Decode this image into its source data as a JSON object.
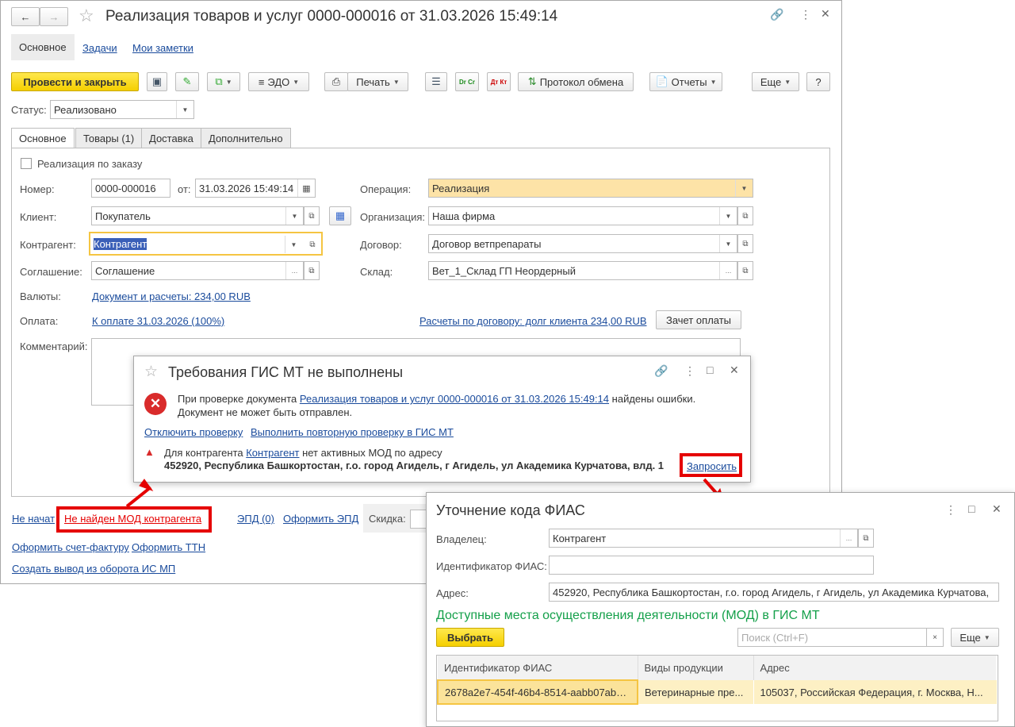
{
  "main": {
    "title": "Реализация товаров и услуг 0000-000016 от 31.03.2026 15:49:14",
    "nav_tabs": [
      "Основное",
      "Задачи",
      "Мои заметки"
    ],
    "toolbar": {
      "post_close": "Провести и закрыть",
      "edo": "ЭДО",
      "print": "Печать",
      "exchange_log": "Протокол обмена",
      "reports": "Отчеты",
      "more": "Еще",
      "help": "?",
      "dr_cr": "Dr Cr",
      "dt_kt": "Дт Кт"
    },
    "status_label": "Статус:",
    "status_value": "Реализовано",
    "tabs": [
      "Основное",
      "Товары (1)",
      "Доставка",
      "Дополнительно"
    ],
    "by_order": "Реализация по заказу",
    "fields": {
      "number_label": "Номер:",
      "number": "0000-000016",
      "from_label": "от:",
      "date": "31.03.2026 15:49:14",
      "client_label": "Клиент:",
      "client": "Покупатель",
      "counterparty_label": "Контрагент:",
      "counterparty": "Контрагент",
      "agreement_label": "Соглашение:",
      "agreement": "Соглашение",
      "currency_label": "Валюты:",
      "currency_link": "Документ и расчеты: 234,00 RUB",
      "payment_label": "Оплата:",
      "payment_link": "К оплате 31.03.2026 (100%)",
      "settlements_link": "Расчеты по договору: долг клиента 234,00 RUB",
      "offset_button": "Зачет оплаты",
      "comment_label": "Комментарий:",
      "operation_label": "Операция:",
      "operation": "Реализация",
      "org_label": "Организация:",
      "org": "Наша фирма",
      "contract_label": "Договор:",
      "contract": "Договор ветпрепараты",
      "warehouse_label": "Склад:",
      "warehouse": "Вет_1_Склад ГП Неордерный"
    },
    "footer": {
      "not_started": "Не начат",
      "mod_not_found": "Не найден МОД контрагента",
      "epd": "ЭПД (0)",
      "make_epd": "Оформить ЭПД",
      "discount_label": "Скидка:",
      "make_invoice": "Оформить счет-фактуру",
      "make_ttn": "Оформить ТТН",
      "create_withdrawal": "Создать вывод из оборота ИС МП"
    }
  },
  "gis_dialog": {
    "title": "Требования ГИС МТ не выполнены",
    "msg_prefix": "При проверке документа",
    "msg_link": "Реализация товаров и услуг 0000-000016 от 31.03.2026 15:49:14",
    "msg_suffix": "найдены ошибки.",
    "msg_line2": "Документ не может быть отправлен.",
    "disable_check": "Отключить проверку",
    "recheck": "Выполнить повторную проверку в ГИС МТ",
    "warn_prefix": "Для контрагента",
    "warn_link": "Контрагент",
    "warn_suffix": "нет активных МОД по адресу",
    "address": "452920, Республика Башкортостан, г.о. город Агидель, г Агидель, ул Академика Курчатова, влд. 1",
    "request": "Запросить"
  },
  "fias_dialog": {
    "title": "Уточнение кода ФИАС",
    "owner_label": "Владелец:",
    "owner": "Контрагент",
    "fias_id_label": "Идентификатор ФИАС:",
    "fias_id": "",
    "address_label": "Адрес:",
    "address": "452920, Республика Башкортостан, г.о. город Агидель, г Агидель, ул Академика Курчатова,",
    "section_title": "Доступные места осуществления деятельности (МОД) в ГИС МТ",
    "select": "Выбрать",
    "search_placeholder": "Поиск (Ctrl+F)",
    "more": "Еще",
    "columns": [
      "Идентификатор ФИАС",
      "Виды продукции",
      "Адрес"
    ],
    "rows": [
      [
        "2678a2e7-454f-46b4-8514-aabb07ab5e...",
        "Ветеринарные пре...",
        "105037, Российская Федерация, г. Москва, Н..."
      ]
    ]
  },
  "colors": {
    "accent_yellow": "#f5cf00",
    "link": "#1a4b9c",
    "error_red": "#e50000",
    "section_green": "#14a04a",
    "row_highlight": "#fdf0c4"
  }
}
